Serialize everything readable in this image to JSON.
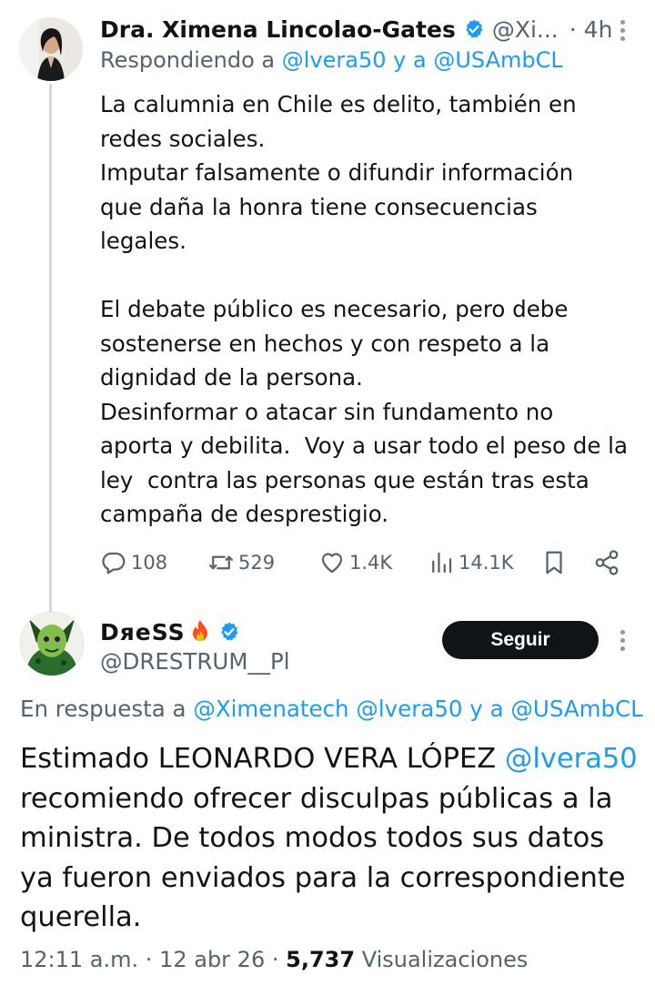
{
  "parent": {
    "author_name": "Dra. Ximena Lincolao-Gates",
    "author_handle": "@Xi...",
    "time_sep": "·",
    "time": "4h",
    "replying_prefix": "Respondiendo a",
    "replying_m1": "@lvera50",
    "replying_mid": "y a",
    "replying_m2": "@USAmbCL",
    "body_p1_l1": "La calumnia en Chile es delito, también en",
    "body_p1_l2": "redes sociales.",
    "body_p1_l3": "Imputar falsamente o difundir información",
    "body_p1_l4": "que daña la honra tiene consecuencias",
    "body_p1_l5": "legales.",
    "body_p2_l1": "El debate público es necesario, pero debe",
    "body_p2_l2": "sostenerse en hechos y con respeto a la",
    "body_p2_l3": "dignidad de la persona.",
    "body_p2_l4": "Desinformar o atacar sin fundamento no",
    "body_p2_l5": "aporta y debilita.  Voy a usar todo el peso de la",
    "body_p2_l6": "ley  contra las personas que están tras esta",
    "body_p2_l7": "campaña de desprestigio.",
    "actions": {
      "replies": "108",
      "reposts": "529",
      "likes": "1.4K",
      "views": "14.1K"
    }
  },
  "reply": {
    "author_name": "DяeSS",
    "author_handle": "@DRESTRUM__Pl",
    "follow_label": "Seguir",
    "context_prefix": "En respuesta a",
    "context_m1": "@Ximenatech",
    "context_m2": "@lvera50",
    "context_mid": "y a",
    "context_m3": "@USAmbCL",
    "body_l1_text": "Estimado LEONARDO VERA LÓPEZ",
    "body_l1_mention": "@lvera50",
    "body_l2": "recomiendo ofrecer disculpas públicas a la",
    "body_l3": "ministra. De todos modos todos sus datos",
    "body_l4": "ya fueron enviados para la correspondiente",
    "body_l5": "querella.",
    "time": "12:11 a.m.",
    "sep": "·",
    "date": "12 abr 26",
    "views_count": "5,737",
    "views_label": "Visualizaciones"
  },
  "colors": {
    "accent": "#1d9bf0",
    "text": "#0f1419",
    "secondary": "#536471",
    "verified": "#1d9bf0",
    "follow_bg": "#0f1419"
  },
  "icons": [
    "verified-badge-icon",
    "more-options-icon",
    "reply-icon",
    "repost-icon",
    "like-icon",
    "views-icon",
    "bookmark-icon",
    "share-icon",
    "fire-emoji-icon"
  ]
}
